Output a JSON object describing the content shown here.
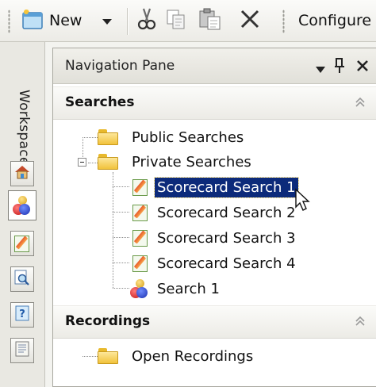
{
  "toolbar": {
    "new_label": "New",
    "configure_label": "Configure"
  },
  "workspaces": {
    "title": "Workspaces"
  },
  "nav_pane": {
    "title": "Navigation Pane",
    "searches_section": {
      "title": "Searches",
      "items": [
        {
          "label": "Public Searches",
          "icon": "folder-icon"
        },
        {
          "label": "Private Searches",
          "icon": "folder-icon",
          "expanded": true
        },
        {
          "label": "Scorecard Search 1",
          "icon": "scorecard-icon",
          "selected": true
        },
        {
          "label": "Scorecard Search 2",
          "icon": "scorecard-icon"
        },
        {
          "label": "Scorecard Search 3",
          "icon": "scorecard-icon"
        },
        {
          "label": "Scorecard Search 4",
          "icon": "scorecard-icon"
        },
        {
          "label": "Search 1",
          "icon": "people-icon"
        }
      ]
    },
    "recordings_section": {
      "title": "Recordings",
      "items": [
        {
          "label": "Open Recordings",
          "icon": "folder-icon"
        }
      ]
    }
  },
  "colors": {
    "selection": "#0c2a7a",
    "folder": "#f1c23b"
  }
}
